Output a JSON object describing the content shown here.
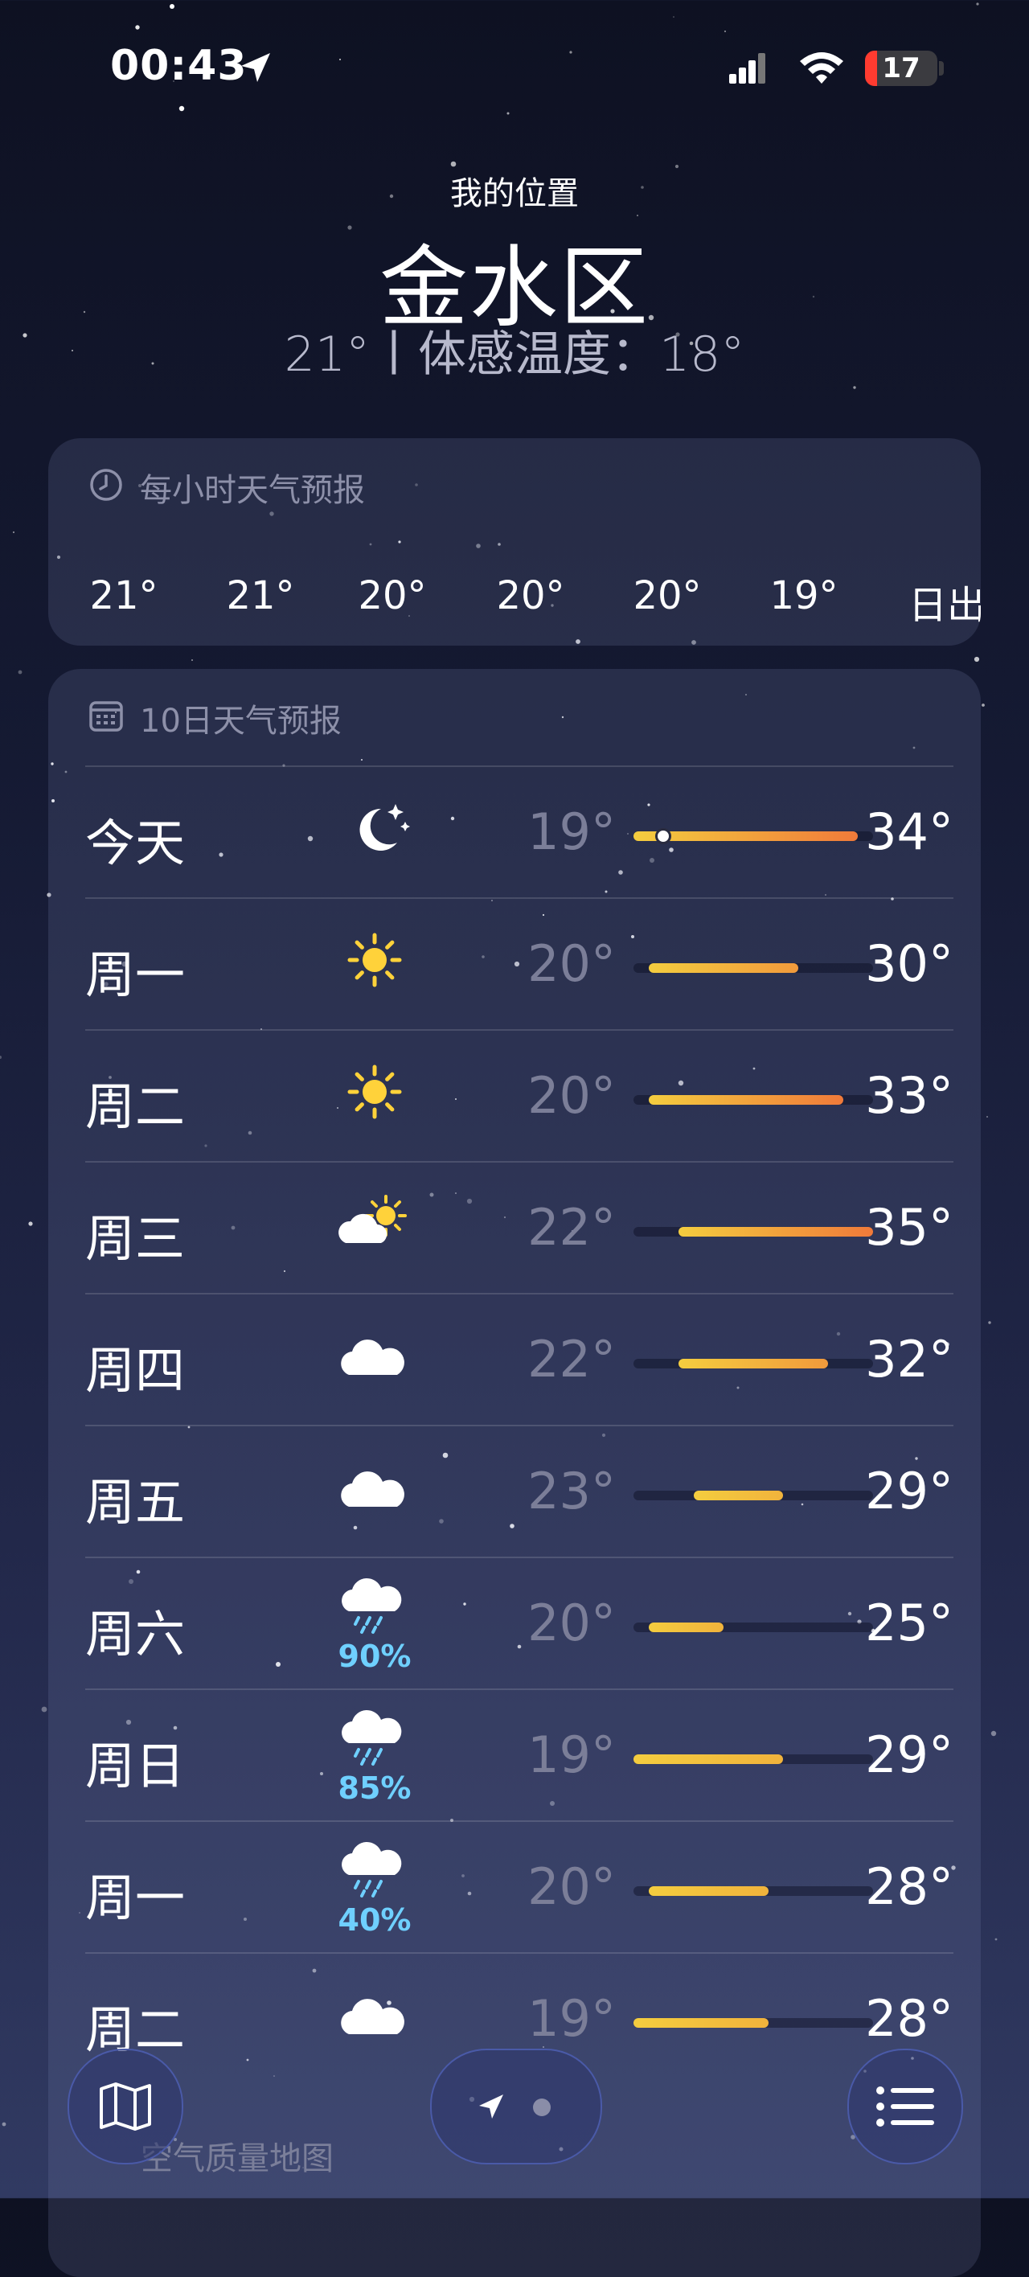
{
  "status_bar": {
    "time": "00:43",
    "battery": "17",
    "battery_level": 0.17,
    "battery_color": "#ff3b30",
    "icons": [
      "location-arrow-icon",
      "signal-icon",
      "wifi-icon",
      "battery-icon"
    ]
  },
  "header": {
    "subtitle": "我的位置",
    "city": "金水区",
    "current": "21°丨体感温度：18°"
  },
  "hourly": {
    "title": "每小时天气预报",
    "icon": "clock-icon",
    "items": [
      "21°",
      "21°",
      "20°",
      "20°",
      "20°",
      "19°",
      "日出"
    ]
  },
  "ten_day": {
    "title": "10日天气预报",
    "icon": "calendar-icon",
    "range_min": 19,
    "range_max": 35,
    "days": [
      {
        "name": "今天",
        "icon": "moon-stars-icon",
        "precip": "",
        "low": "19°",
        "high": "34°",
        "low_val": 19,
        "high_val": 34,
        "current_val": 21
      },
      {
        "name": "周一",
        "icon": "sun-icon",
        "precip": "",
        "low": "20°",
        "high": "30°",
        "low_val": 20,
        "high_val": 30
      },
      {
        "name": "周二",
        "icon": "sun-icon",
        "precip": "",
        "low": "20°",
        "high": "33°",
        "low_val": 20,
        "high_val": 33
      },
      {
        "name": "周三",
        "icon": "partly-sunny-icon",
        "precip": "",
        "low": "22°",
        "high": "35°",
        "low_val": 22,
        "high_val": 35
      },
      {
        "name": "周四",
        "icon": "cloud-icon",
        "precip": "",
        "low": "22°",
        "high": "32°",
        "low_val": 22,
        "high_val": 32
      },
      {
        "name": "周五",
        "icon": "cloud-icon",
        "precip": "",
        "low": "23°",
        "high": "29°",
        "low_val": 23,
        "high_val": 29
      },
      {
        "name": "周六",
        "icon": "rain-cloud-icon",
        "precip": "90%",
        "low": "20°",
        "high": "25°",
        "low_val": 20,
        "high_val": 25
      },
      {
        "name": "周日",
        "icon": "rain-cloud-icon",
        "precip": "85%",
        "low": "19°",
        "high": "29°",
        "low_val": 19,
        "high_val": 29
      },
      {
        "name": "周一",
        "icon": "rain-cloud-icon",
        "precip": "40%",
        "low": "20°",
        "high": "28°",
        "low_val": 20,
        "high_val": 28
      },
      {
        "name": "周二",
        "icon": "cloud-icon",
        "precip": "",
        "low": "19°",
        "high": "28°",
        "low_val": 19,
        "high_val": 28
      }
    ]
  },
  "air_quality": {
    "title": "空气质量地图"
  },
  "bottom_bar": {
    "map_icon": "map-icon",
    "pager_icons": [
      "location-arrow-icon",
      "page-dot-icon"
    ],
    "list_icon": "list-icon"
  },
  "colors": {
    "accent_border": "#4a5aa8",
    "precip": "#6fd0ff",
    "sun": "#ffd23a",
    "bar_cool": "#f4cd3f",
    "bar_warm": "#f07a3a"
  }
}
